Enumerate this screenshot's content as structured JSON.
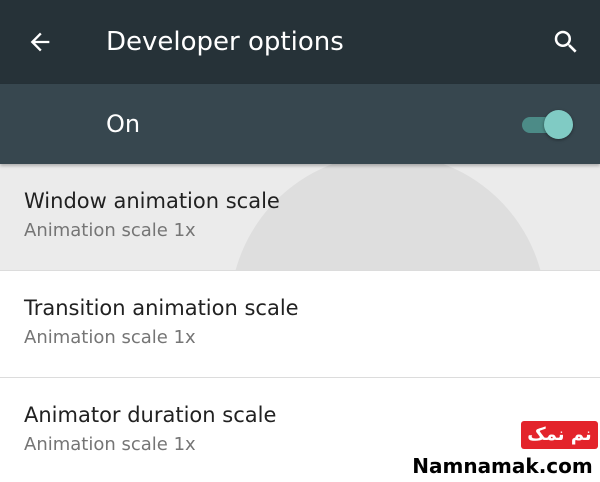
{
  "toolbar": {
    "title": "Developer options",
    "back_icon": "arrow-back-icon",
    "search_icon": "search-icon",
    "background": "#263238"
  },
  "master_switch": {
    "label": "On",
    "checked": true,
    "background": "#37474f",
    "thumb_color": "#80cbc4"
  },
  "preferences": [
    {
      "title": "Window animation scale",
      "summary": "Animation scale 1x",
      "pressed": true
    },
    {
      "title": "Transition animation scale",
      "summary": "Animation scale 1x",
      "pressed": false
    },
    {
      "title": "Animator duration scale",
      "summary": "Animation scale 1x",
      "pressed": false
    }
  ],
  "watermark": {
    "badge_text": "نم نمک",
    "site_text": "Namnamak.com",
    "badge_color": "#e3242b"
  }
}
